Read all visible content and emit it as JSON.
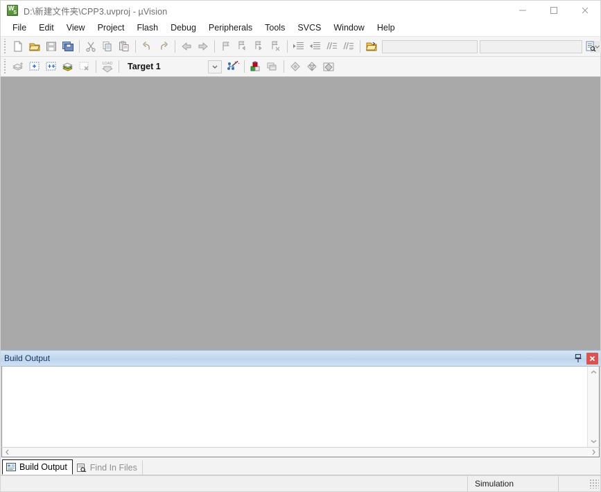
{
  "window": {
    "title": "D:\\新建文件夹\\CPP3.uvproj - µVision",
    "app_icon": "uvision-logo-icon",
    "controls": {
      "minimize": "minimize-icon",
      "maximize": "maximize-icon",
      "close": "close-icon"
    }
  },
  "menubar": {
    "items": [
      {
        "label": "File"
      },
      {
        "label": "Edit"
      },
      {
        "label": "View"
      },
      {
        "label": "Project"
      },
      {
        "label": "Flash"
      },
      {
        "label": "Debug"
      },
      {
        "label": "Peripherals"
      },
      {
        "label": "Tools"
      },
      {
        "label": "SVCS"
      },
      {
        "label": "Window"
      },
      {
        "label": "Help"
      }
    ]
  },
  "toolbar_file": {
    "buttons": [
      {
        "name": "new-file-button",
        "icon": "new-file-icon",
        "enabled": true
      },
      {
        "name": "open-file-button",
        "icon": "open-folder-icon",
        "enabled": true
      },
      {
        "name": "save-button",
        "icon": "save-disk-icon",
        "enabled": false
      },
      {
        "name": "save-all-button",
        "icon": "save-all-icon",
        "enabled": true
      },
      {
        "name": "cut-button",
        "icon": "scissors-icon",
        "enabled": false
      },
      {
        "name": "copy-button",
        "icon": "copy-icon",
        "enabled": false
      },
      {
        "name": "paste-button",
        "icon": "paste-icon",
        "enabled": false
      },
      {
        "name": "undo-button",
        "icon": "undo-arrow-icon",
        "enabled": false
      },
      {
        "name": "redo-button",
        "icon": "redo-arrow-icon",
        "enabled": false
      },
      {
        "name": "navigate-back-button",
        "icon": "arrow-left-icon",
        "enabled": false
      },
      {
        "name": "navigate-forward-button",
        "icon": "arrow-right-icon",
        "enabled": false
      },
      {
        "name": "toggle-bookmark-button",
        "icon": "bookmark-flag-icon",
        "enabled": false
      },
      {
        "name": "previous-bookmark-button",
        "icon": "bookmark-prev-icon",
        "enabled": false
      },
      {
        "name": "next-bookmark-button",
        "icon": "bookmark-next-icon",
        "enabled": false
      },
      {
        "name": "clear-bookmarks-button",
        "icon": "bookmark-clear-icon",
        "enabled": false
      },
      {
        "name": "indent-button",
        "icon": "indent-right-icon",
        "enabled": false
      },
      {
        "name": "outdent-button",
        "icon": "indent-left-icon",
        "enabled": false
      },
      {
        "name": "comment-button",
        "icon": "comment-lines-icon",
        "enabled": false
      },
      {
        "name": "uncomment-button",
        "icon": "uncomment-lines-icon",
        "enabled": false
      },
      {
        "name": "open-project-button",
        "icon": "open-project-folder-icon",
        "enabled": true
      }
    ],
    "search_box": {
      "name": "find-in-files-input",
      "value": "",
      "placeholder": ""
    },
    "combo_box": {
      "name": "find-combo-input",
      "value": "",
      "placeholder": "",
      "arrow_icon": "chevron-down-icon"
    },
    "right_buttons": [
      {
        "name": "find-in-files-button",
        "icon": "find-in-files-icon",
        "enabled": true
      },
      {
        "name": "incremental-find-button",
        "icon": "incremental-find-icon",
        "enabled": false
      },
      {
        "name": "debug-find-button",
        "icon": "debug-magnifier-icon",
        "enabled": true
      },
      {
        "name": "configure-toolbar-button",
        "icon": "gray-circle-icon",
        "enabled": false
      },
      {
        "name": "insert-breakpoint-button",
        "icon": "hollow-circle-icon",
        "enabled": false
      },
      {
        "name": "kill-breakpoints-button",
        "icon": "red-circles-icon",
        "enabled": true
      },
      {
        "name": "disable-breakpoint-button",
        "icon": "red-yellow-icon",
        "enabled": true
      }
    ]
  },
  "toolbar_build": {
    "buttons": [
      {
        "name": "translate-file-button",
        "icon": "translate-stack-icon",
        "enabled": false
      },
      {
        "name": "build-target-button",
        "icon": "build-target-icon",
        "enabled": true
      },
      {
        "name": "rebuild-all-button",
        "icon": "rebuild-all-icon",
        "enabled": true
      },
      {
        "name": "batch-build-button",
        "icon": "batch-build-icon",
        "enabled": true
      },
      {
        "name": "stop-build-button",
        "icon": "stop-build-icon",
        "enabled": false
      },
      {
        "name": "download-button",
        "icon": "load-download-icon",
        "enabled": false
      }
    ],
    "target_selector": {
      "name": "target-selector",
      "value": "Target 1",
      "arrow_icon": "chevron-down-icon"
    },
    "right_buttons": [
      {
        "name": "target-options-wizard-button",
        "icon": "magic-wand-icon",
        "enabled": true
      },
      {
        "name": "options-for-target-button",
        "icon": "options-blocks-icon",
        "enabled": true
      },
      {
        "name": "manage-project-items-button",
        "icon": "manage-windows-icon",
        "enabled": false
      },
      {
        "name": "manage-components-button",
        "icon": "diamond-gray-icon",
        "enabled": false
      },
      {
        "name": "pack-installer-button",
        "icon": "diamond-filter-icon",
        "enabled": false
      },
      {
        "name": "manage-run-time-button",
        "icon": "diamond-env-icon",
        "enabled": false
      }
    ]
  },
  "build_output": {
    "title": "Build Output",
    "pin_icon": "pin-icon",
    "close_icon": "close-x-icon",
    "text": "",
    "scroll": {
      "up_icon": "chevron-up-icon",
      "down_icon": "chevron-down-icon",
      "left_icon": "chevron-left-icon",
      "right_icon": "chevron-right-icon"
    }
  },
  "bottom_tabs": [
    {
      "label": "Build Output",
      "icon": "build-output-icon",
      "active": true
    },
    {
      "label": "Find In Files",
      "icon": "find-in-files-icon",
      "active": false
    }
  ],
  "statusbar": {
    "simulation": "Simulation",
    "resize_grip": "resize-grip-icon"
  },
  "colors": {
    "client_background": "#a9a9a9",
    "panel_header_start": "#d6e5f5",
    "panel_header_end": "#cfe1f4",
    "close_button": "#d9534f",
    "title_text": "#6e6e6e"
  }
}
